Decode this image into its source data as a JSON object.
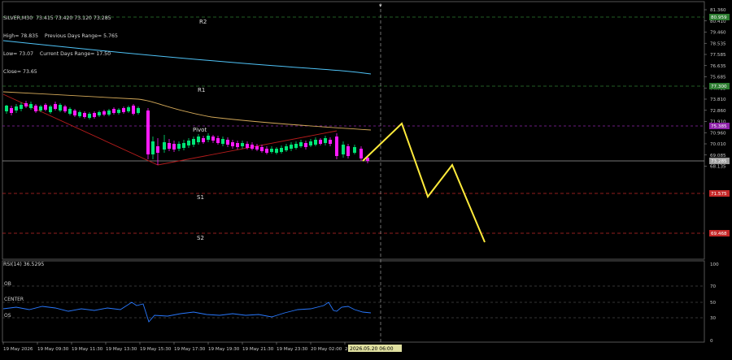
{
  "header": {
    "symbol_line": "SILVER,M30  73.415 73.420 73.120 73.285",
    "high_line": "High= 78.835    Previous Days Range= 5.765",
    "low_line": "Low= 73.07    Current Days Range= 17.50",
    "close_line": "Close= 73.65"
  },
  "levels": {
    "r2": "R2",
    "r1": "R1",
    "pivot": "Pivot",
    "s1": "S1",
    "s2": "S2"
  },
  "price_axis": {
    "ticks": [
      "81.360",
      "80.410",
      "79.460",
      "78.535",
      "77.585",
      "76.635",
      "75.685",
      "74.735",
      "73.810",
      "72.860",
      "71.910",
      "70.960",
      "70.010",
      "69.085",
      "68.135"
    ],
    "badges": [
      {
        "value": "80.959",
        "color": "#2e7d32"
      },
      {
        "value": "77.300",
        "color": "#2e7d32"
      },
      {
        "value": "75.385",
        "color": "#8e24aa"
      },
      {
        "value": "73.285",
        "color": "#9e9e9e"
      },
      {
        "value": "71.575",
        "color": "#c62828"
      },
      {
        "value": "69.468",
        "color": "#c62828"
      }
    ]
  },
  "rsi": {
    "label": "RSI(14) 36.5295",
    "ob": "OB",
    "center": "CENTER",
    "os": "OS",
    "ticks": [
      "100",
      "70",
      "50",
      "30",
      "0"
    ]
  },
  "time_axis": {
    "ticks": [
      "19 May 2026",
      "19 May 09:30",
      "19 May 11:30",
      "19 May 13:30",
      "19 May 15:30",
      "19 May 17:30",
      "19 May 19:30",
      "19 May 21:30",
      "19 May 23:30",
      "20 May 02:00",
      "20 Ma"
    ],
    "cursor_label": "2026.05.20 06:00"
  },
  "colors": {
    "bull": "#00e676",
    "bear": "#ff1aff",
    "ma_blue": "#4fc3f7",
    "ma_tan": "#d4a959",
    "trend": "#b71c1c",
    "forecast": "#ffeb3b",
    "rsi_line": "#2979ff"
  }
}
